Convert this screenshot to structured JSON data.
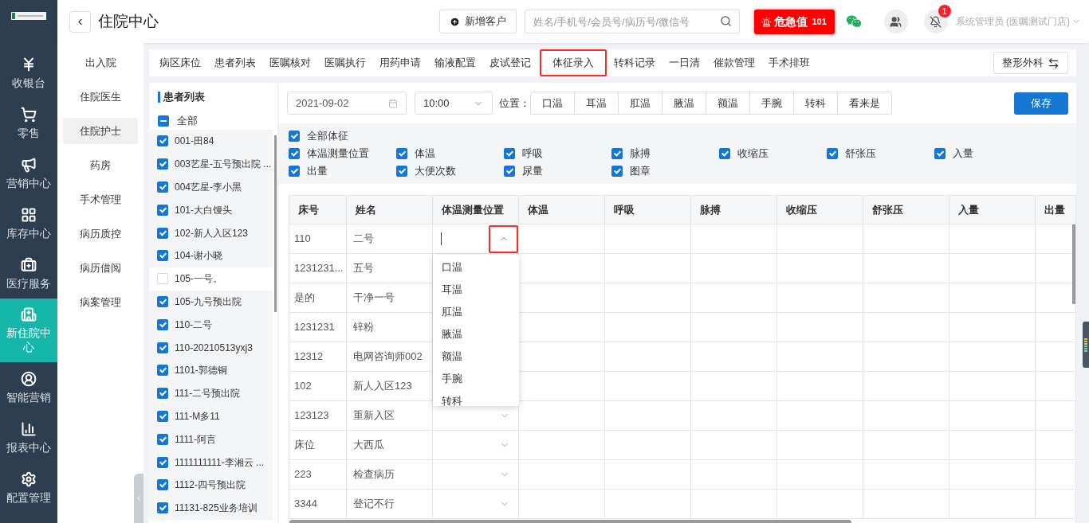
{
  "sidebar": {
    "items": [
      {
        "label": "收银台",
        "selected": false
      },
      {
        "label": "零售",
        "selected": false
      },
      {
        "label": "营销中心",
        "selected": false
      },
      {
        "label": "库存中心",
        "selected": false
      },
      {
        "label": "医疗服务",
        "selected": false
      },
      {
        "label": "新住院中心",
        "selected": true
      },
      {
        "label": "智能营销",
        "selected": false
      },
      {
        "label": "报表中心",
        "selected": false
      },
      {
        "label": "配置管理",
        "selected": false
      }
    ]
  },
  "header": {
    "title": "住院中心",
    "add_button": "新增客户",
    "search": {
      "placeholder": "姓名/手机号/会员号/病历号/微信号"
    },
    "alert_button": {
      "label": "危急值",
      "count": "101"
    },
    "notification_badge": "1",
    "user": "系统管理员 (医嘱测试门店)"
  },
  "subnav": [
    {
      "label": "出入院",
      "selected": false
    },
    {
      "label": "住院医生",
      "selected": false
    },
    {
      "label": "住院护士",
      "selected": true
    },
    {
      "label": "药房",
      "selected": false
    },
    {
      "label": "手术管理",
      "selected": false
    },
    {
      "label": "病历质控",
      "selected": false
    },
    {
      "label": "病历借阅",
      "selected": false
    },
    {
      "label": "病案管理",
      "selected": false
    }
  ],
  "tabs": [
    {
      "label": "病区床位",
      "selected": false
    },
    {
      "label": "患者列表",
      "selected": false
    },
    {
      "label": "医嘱核对",
      "selected": false
    },
    {
      "label": "医嘱执行",
      "selected": false
    },
    {
      "label": "用药申请",
      "selected": false
    },
    {
      "label": "输液配置",
      "selected": false
    },
    {
      "label": "皮试登记",
      "selected": false
    },
    {
      "label": "体征录入",
      "selected": true
    },
    {
      "label": "转科记录",
      "selected": false
    },
    {
      "label": "一日清",
      "selected": false
    },
    {
      "label": "催款管理",
      "selected": false
    },
    {
      "label": "手术排班",
      "selected": false
    }
  ],
  "department_button": "整形外科",
  "patient_list": {
    "title": "患者列表",
    "all": {
      "label": "全部",
      "indeterminate": true
    },
    "patients": [
      {
        "label": "001-田84",
        "checked": true
      },
      {
        "label": "003艺星-五号预出院 ...",
        "checked": true
      },
      {
        "label": "004艺星-李小黑",
        "checked": true
      },
      {
        "label": "101-大白馒头",
        "checked": true
      },
      {
        "label": "102-新人入区123",
        "checked": true
      },
      {
        "label": "104-谢小晓",
        "checked": true
      },
      {
        "label": "105-一号。",
        "checked": false
      },
      {
        "label": "105-九号预出院",
        "checked": true
      },
      {
        "label": "110-二号",
        "checked": true
      },
      {
        "label": "110-20210513yxj3",
        "checked": true
      },
      {
        "label": "1101-郭德铜",
        "checked": true
      },
      {
        "label": "111-二号预出院",
        "checked": true
      },
      {
        "label": "111-M多11",
        "checked": true
      },
      {
        "label": "1111-阿言",
        "checked": true
      },
      {
        "label": "1111111111-李湘云 ...",
        "checked": true
      },
      {
        "label": "1112-四号预出院",
        "checked": true
      },
      {
        "label": "11131-825业务培训",
        "checked": true
      }
    ]
  },
  "form": {
    "date": "2021-09-02",
    "time": "10:00",
    "position_label": "位置：",
    "positions": [
      "口温",
      "耳温",
      "肛温",
      "腋温",
      "额温",
      "手腕",
      "转科",
      "看来是"
    ],
    "save_button": "保存"
  },
  "vitals": {
    "all": {
      "label": "全部体征",
      "checked": true
    },
    "items": [
      {
        "label": "体温测量位置",
        "checked": true
      },
      {
        "label": "体温",
        "checked": true
      },
      {
        "label": "呼吸",
        "checked": true
      },
      {
        "label": "脉搏",
        "checked": true
      },
      {
        "label": "收缩压",
        "checked": true
      },
      {
        "label": "舒张压",
        "checked": true
      },
      {
        "label": "入量",
        "checked": true
      },
      {
        "label": "出量",
        "checked": true
      },
      {
        "label": "大便次数",
        "checked": true
      },
      {
        "label": "尿量",
        "checked": true
      },
      {
        "label": "图章",
        "checked": true
      }
    ]
  },
  "table": {
    "columns": [
      "床号",
      "姓名",
      "体温测量位置",
      "体温",
      "呼吸",
      "脉搏",
      "收缩压",
      "舒张压",
      "入量",
      "出量"
    ],
    "rows": [
      {
        "bed": "110",
        "name": "二号",
        "open": true
      },
      {
        "bed": "1231231...",
        "name": "五号",
        "open": false
      },
      {
        "bed": "是的",
        "name": "干净一号",
        "open": false
      },
      {
        "bed": "1231231",
        "name": "锌粉",
        "open": false
      },
      {
        "bed": "12312",
        "name": "电网咨询师002",
        "open": false
      },
      {
        "bed": "102",
        "name": "新人入区123",
        "open": false
      },
      {
        "bed": "123123",
        "name": "重新入区",
        "open": false
      },
      {
        "bed": "床位",
        "name": "大西瓜",
        "open": false
      },
      {
        "bed": "223",
        "name": "检查病历",
        "open": false
      },
      {
        "bed": "3344",
        "name": "登记不行",
        "open": false
      }
    ],
    "dropdown_options": [
      "口温",
      "耳温",
      "肛温",
      "腋温",
      "额温",
      "手腕",
      "转科"
    ]
  }
}
